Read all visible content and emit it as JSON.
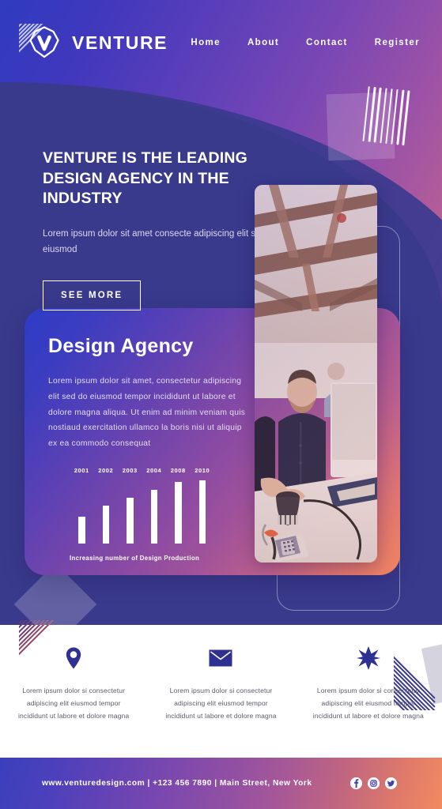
{
  "brand": {
    "name": "VENTURE",
    "logo_icon": "venture-v-badge-icon"
  },
  "nav": {
    "items": [
      {
        "label": "Home"
      },
      {
        "label": "About"
      },
      {
        "label": "Contact"
      },
      {
        "label": "Register"
      }
    ]
  },
  "hero": {
    "heading": "VENTURE IS THE LEADING DESIGN AGENCY IN THE INDUSTRY",
    "subtext": "Lorem ipsum dolor sit amet consecte adipiscing elit sed do eiusmod",
    "cta_label": "SEE MORE",
    "photo_alt": "man-working-at-desk-in-office-photo"
  },
  "agency_card": {
    "title": "Design Agency",
    "body": "Lorem ipsum dolor sit amet, consectetur adipiscing elit sed do eiusmod tempor incididunt ut labore et dolore magna aliqua. Ut enim ad minim veniam quis nostiaud exercitation ullamco la boris nisi ut aliquip ex ea commodo consequat"
  },
  "chart_data": {
    "type": "bar",
    "title": "Increasing number of Design Production",
    "categories": [
      "2001",
      "2002",
      "2003",
      "2004",
      "2008",
      "2010"
    ],
    "values": [
      34,
      48,
      58,
      68,
      78,
      80
    ],
    "xlabel": "",
    "ylabel": "",
    "ylim": [
      0,
      80
    ],
    "grid": false,
    "legend": "none",
    "bar_color": "#ffffff",
    "label_position": "top"
  },
  "features": {
    "items": [
      {
        "icon": "location-pin-icon",
        "text": "Lorem ipsum dolor si consectetur adipiscing elit eiusmod tempor incididunt ut labore et dolore magna"
      },
      {
        "icon": "envelope-icon",
        "text": "Lorem ipsum dolor si consectetur adipiscing elit eiusmod tempor incididunt ut labore et dolore magna"
      },
      {
        "icon": "star-burst-icon",
        "text": "Lorem ipsum dolor si consectetur adipiscing elit eiusmod tempor incididunt ut labore et dolore magna"
      }
    ]
  },
  "footer": {
    "contact_line": "www.venturedesign.com  |  +123 456 7890  |  Main Street, New York",
    "social": [
      {
        "name": "facebook-icon",
        "glyph": "f"
      },
      {
        "name": "instagram-icon",
        "glyph": "□"
      },
      {
        "name": "twitter-icon",
        "glyph": "❧"
      }
    ]
  },
  "colors": {
    "brand_blue": "#2f3bbf",
    "brand_purple": "#8c4ba3",
    "brand_coral": "#f2855f",
    "indigo_dark": "#3b3a8f",
    "icon_navy": "#2e3192",
    "body_gray": "#5a5a6e"
  }
}
